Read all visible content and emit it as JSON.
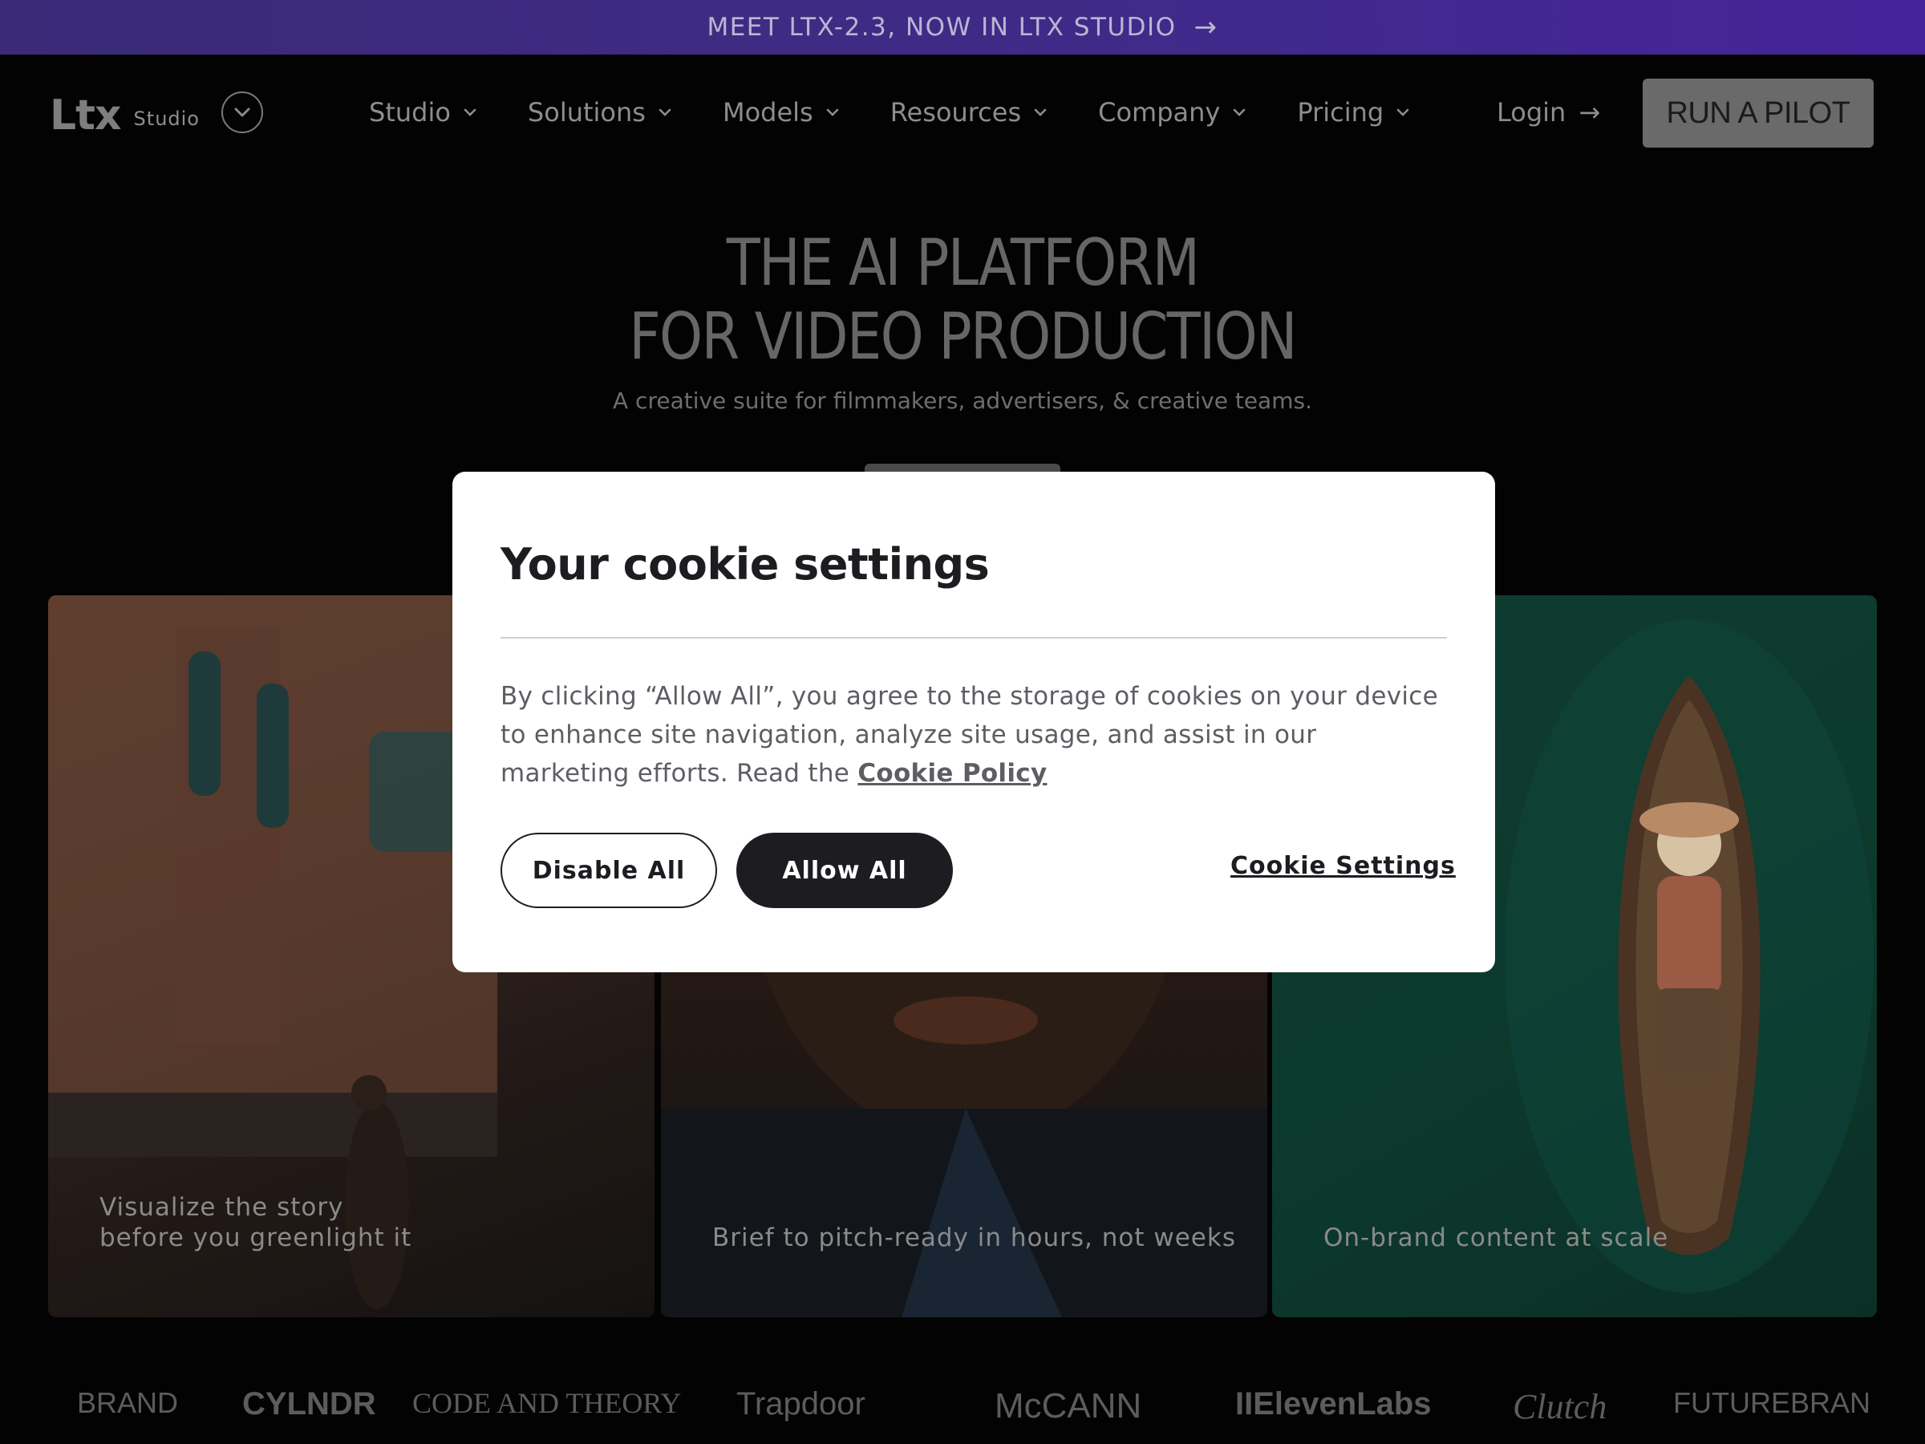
{
  "banner": {
    "text": "MEET LTX-2.3, NOW IN LTX STUDIO",
    "arrow_icon": "arrow-right-icon"
  },
  "header": {
    "logo_mark": "Ltx",
    "logo_sub": "Studio",
    "nav": [
      {
        "label": "Studio"
      },
      {
        "label": "Solutions"
      },
      {
        "label": "Models"
      },
      {
        "label": "Resources"
      },
      {
        "label": "Company"
      },
      {
        "label": "Pricing"
      }
    ],
    "login_label": "Login",
    "cta_label": "RUN A PILOT"
  },
  "hero": {
    "title_line1": "THE AI PLATFORM",
    "title_line2": "FOR VIDEO PRODUCTION",
    "subtitle": "A creative suite for filmmakers, advertisers, & creative teams."
  },
  "cards": [
    {
      "caption": "Visualize the story\nbefore you greenlight it"
    },
    {
      "caption": "Brief to pitch-ready in hours, not weeks"
    },
    {
      "caption": "On-brand content at scale"
    }
  ],
  "logos": [
    "BRAND",
    "CYLNDR",
    "CODE AND THEORY",
    "Trapdoor",
    "McCANN",
    "IIElevenLabs",
    "Clutch",
    "FUTUREBRAN"
  ],
  "cookie_modal": {
    "title": "Your cookie settings",
    "body": "By clicking “Allow All”, you agree to the storage of cookies on your device to enhance site navigation, analyze site usage, and assist in our marketing efforts. Read the",
    "policy_link": "Cookie Policy",
    "disable_label": "Disable All",
    "allow_label": "Allow All",
    "settings_label": "Cookie Settings"
  },
  "colors": {
    "banner": "#3f2b86",
    "modal_bg": "#ffffff",
    "modal_dark": "#1d1d21",
    "cta_bg": "#6a6a6a"
  }
}
